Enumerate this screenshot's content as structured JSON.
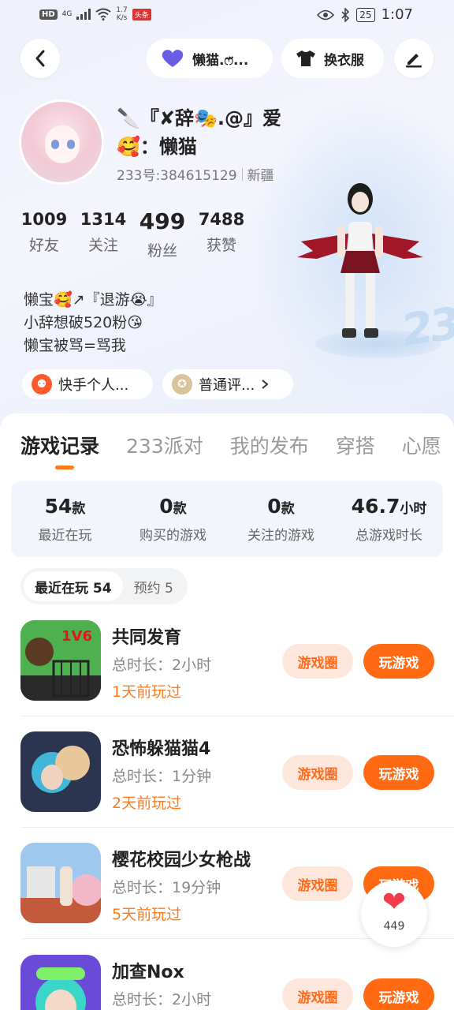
{
  "status_bar": {
    "hd": "HD",
    "signal": "4G",
    "net_speed_value": "1.7",
    "net_speed_unit": "K/s",
    "app_badge": "头条",
    "battery": "25",
    "time": "1:07"
  },
  "header": {
    "group_label": "懒猫.ෆ̈...",
    "wardrobe_label": "换衣服"
  },
  "profile": {
    "nickname_line1": "🔪『✘辞🎭.@』爱",
    "nickname_line2": "🥰：懒猫",
    "uid": "233号:384615129",
    "region": "新疆",
    "stats": [
      {
        "num": "1009",
        "label": "好友"
      },
      {
        "num": "1314",
        "label": "关注"
      },
      {
        "num": "499",
        "label": "粉丝"
      },
      {
        "num": "7488",
        "label": "获赞"
      }
    ],
    "bio_lines": [
      "懒宝🥰↗『退游😭』",
      "小辞想破520粉😘",
      "懒宝被骂=骂我"
    ],
    "chips": [
      {
        "label": "快手个人...",
        "icon": "kuaishou-icon"
      },
      {
        "label": "普通评...",
        "icon": "rating-badge-icon"
      }
    ],
    "watermark": "233"
  },
  "tabs": [
    "游戏记录",
    "233派对",
    "我的发布",
    "穿搭",
    "心愿"
  ],
  "summary": [
    {
      "num": "54",
      "unit": "款",
      "label": "最近在玩"
    },
    {
      "num": "0",
      "unit": "款",
      "label": "购买的游戏"
    },
    {
      "num": "0",
      "unit": "款",
      "label": "关注的游戏"
    },
    {
      "num": "46.7",
      "unit": "小时",
      "label": "总游戏时长"
    }
  ],
  "segment": {
    "recent": "最近在玩 54",
    "reserve": "预约 5"
  },
  "games": [
    {
      "title": "共同发育",
      "duration": "总时长：2小时",
      "when": "1天前玩过",
      "icon_text": "1V6"
    },
    {
      "title": "恐怖躲猫猫4",
      "duration": "总时长：1分钟",
      "when": "2天前玩过"
    },
    {
      "title": "樱花校园少女枪战",
      "duration": "总时长：19分钟",
      "when": "5天前玩过"
    },
    {
      "title": "加查Nox",
      "duration": "总时长：2小时",
      "when": ""
    }
  ],
  "game_buttons": {
    "circle": "游戏圈",
    "play": "玩游戏"
  },
  "like_float": {
    "count": "449"
  },
  "colors": {
    "accent": "#ff6a12",
    "accent_light": "#fde7dc",
    "like": "#f23c4a"
  }
}
